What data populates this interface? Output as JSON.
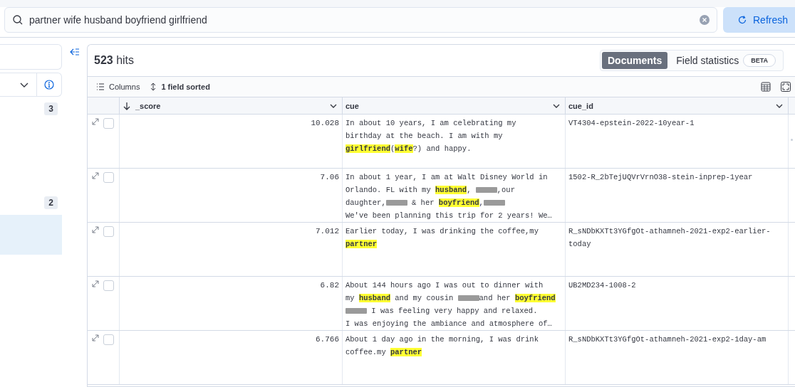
{
  "search": {
    "value": "partner wife husband boyfriend girlfriend"
  },
  "refresh_button": {
    "label": "Refresh"
  },
  "sidebar": {
    "items": [
      {
        "count": "3",
        "selected": false
      },
      {
        "count": "2",
        "selected": false
      },
      {
        "selected": true
      }
    ]
  },
  "hits": "**523** hits",
  "view_tabs": [
    {
      "label": "Documents",
      "selected": true
    },
    {
      "label": "Field statistics",
      "selected": false,
      "badge": "BETA"
    }
  ],
  "toolbar": {
    "columns_button": "Columns",
    "sort_button": "1 field sorted"
  },
  "table": {
    "columns": [
      {
        "label": "_score",
        "sorted_descending": true
      },
      {
        "label": "cue"
      },
      {
        "label": "cue_id"
      }
    ],
    "rows": [
      {
        "checked": false,
        "score": "10.028",
        "cue_id": "VT4304-epstein-2022-10year-1",
        "cue": [
          [
            {
              "kind": "plain",
              "text": "In about 10 years, I am celebrating my"
            }
          ],
          [
            {
              "kind": "plain",
              "text": "birthday at the beach. I am with my"
            }
          ],
          [
            {
              "kind": "highlight",
              "text": "girlfriend"
            },
            {
              "kind": "plain",
              "text": "("
            },
            {
              "kind": "highlight",
              "text": "wife"
            },
            {
              "kind": "plain",
              "text": "?) and happy."
            }
          ]
        ]
      },
      {
        "checked": false,
        "score": "7.06",
        "cue_id": "1502-R_2bTejUQVrVrnO38-stein-inprep-1year",
        "cue": [
          [
            {
              "kind": "plain",
              "text": "In about 1 year, I am at Walt Disney World in"
            }
          ],
          [
            {
              "kind": "plain",
              "text": "Orlando. FL with my "
            },
            {
              "kind": "highlight",
              "text": "husband"
            },
            {
              "kind": "plain",
              "text": ", "
            },
            {
              "kind": "redacted"
            },
            {
              "kind": "plain",
              "text": ",our"
            }
          ],
          [
            {
              "kind": "plain",
              "text": "daughter,"
            },
            {
              "kind": "redacted"
            },
            {
              "kind": "plain",
              "text": " & her "
            },
            {
              "kind": "highlight",
              "text": "boyfriend"
            },
            {
              "kind": "plain",
              "text": ","
            },
            {
              "kind": "redacted"
            }
          ],
          [
            {
              "kind": "plain",
              "text": "We've been planning this trip for 2 years! We…"
            }
          ]
        ]
      },
      {
        "checked": false,
        "score": "7.012",
        "cue_id": "R_sNDbKXTt3YGfgOt-athamneh-2021-exp2-earlier-today",
        "cue": [
          [
            {
              "kind": "plain",
              "text": "Earlier today, I was drinking the coffee,my"
            }
          ],
          [
            {
              "kind": "highlight",
              "text": "partner"
            }
          ]
        ]
      },
      {
        "checked": false,
        "score": "6.82",
        "cue_id": "UB2MD234-1008-2",
        "cue": [
          [
            {
              "kind": "plain",
              "text": "About 144 hours ago I was out to dinner with"
            }
          ],
          [
            {
              "kind": "plain",
              "text": "my "
            },
            {
              "kind": "highlight",
              "text": "husband"
            },
            {
              "kind": "plain",
              "text": " and my cousin "
            },
            {
              "kind": "redacted"
            },
            {
              "kind": "plain",
              "text": "and her "
            },
            {
              "kind": "highlight",
              "text": "boyfriend"
            }
          ],
          [
            {
              "kind": "redacted"
            },
            {
              "kind": "plain",
              "text": " I was feeling very happy and relaxed."
            }
          ],
          [
            {
              "kind": "plain",
              "text": "I was enjoying the ambiance and atmosphere of…"
            }
          ]
        ]
      },
      {
        "checked": false,
        "score": "6.766",
        "cue_id": "R_sNDbKXTt3YGfgOt-athamneh-2021-exp2-1day-am",
        "cue": [
          [
            {
              "kind": "plain",
              "text": "About 1 day ago in the morning, I was drink"
            }
          ],
          [
            {
              "kind": "plain",
              "text": "coffee.my "
            },
            {
              "kind": "highlight",
              "text": "partner"
            }
          ]
        ]
      }
    ]
  }
}
